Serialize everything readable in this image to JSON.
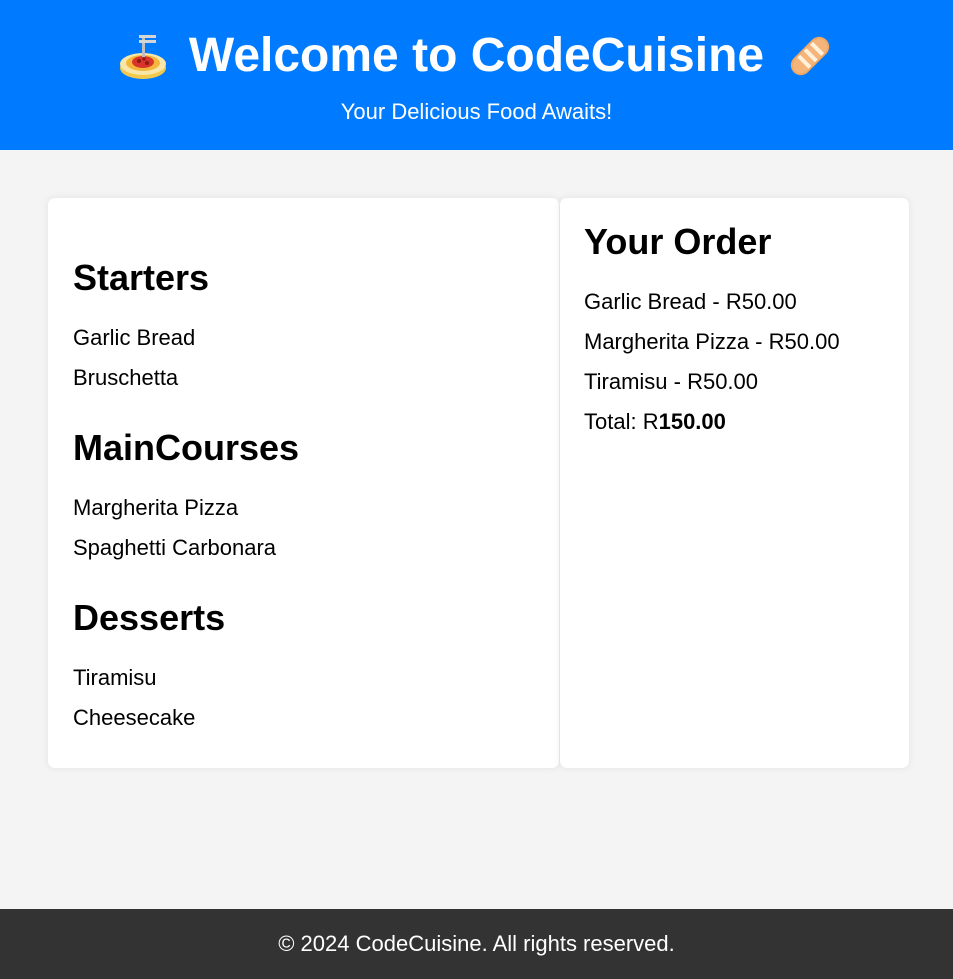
{
  "header": {
    "title": "Welcome to CodeCuisine",
    "subtitle": "Your Delicious Food Awaits!",
    "left_icon": "spaghetti-emoji",
    "right_icon": "bread-emoji"
  },
  "menu": {
    "sections": [
      {
        "title": "Starters",
        "items": [
          "Garlic Bread",
          "Bruschetta"
        ]
      },
      {
        "title": "MainCourses",
        "items": [
          "Margherita Pizza",
          "Spaghetti Carbonara"
        ]
      },
      {
        "title": "Desserts",
        "items": [
          "Tiramisu",
          "Cheesecake"
        ]
      }
    ]
  },
  "order": {
    "title": "Your Order",
    "lines": [
      "Garlic Bread - R50.00",
      "Margherita Pizza - R50.00",
      "Tiramisu - R50.00"
    ],
    "total_label": "Total: R",
    "total_value": "150.00"
  },
  "footer": {
    "text": "© 2024 CodeCuisine. All rights reserved."
  },
  "colors": {
    "header_bg": "#007bff",
    "page_bg": "#f4f4f4",
    "footer_bg": "#333333"
  }
}
